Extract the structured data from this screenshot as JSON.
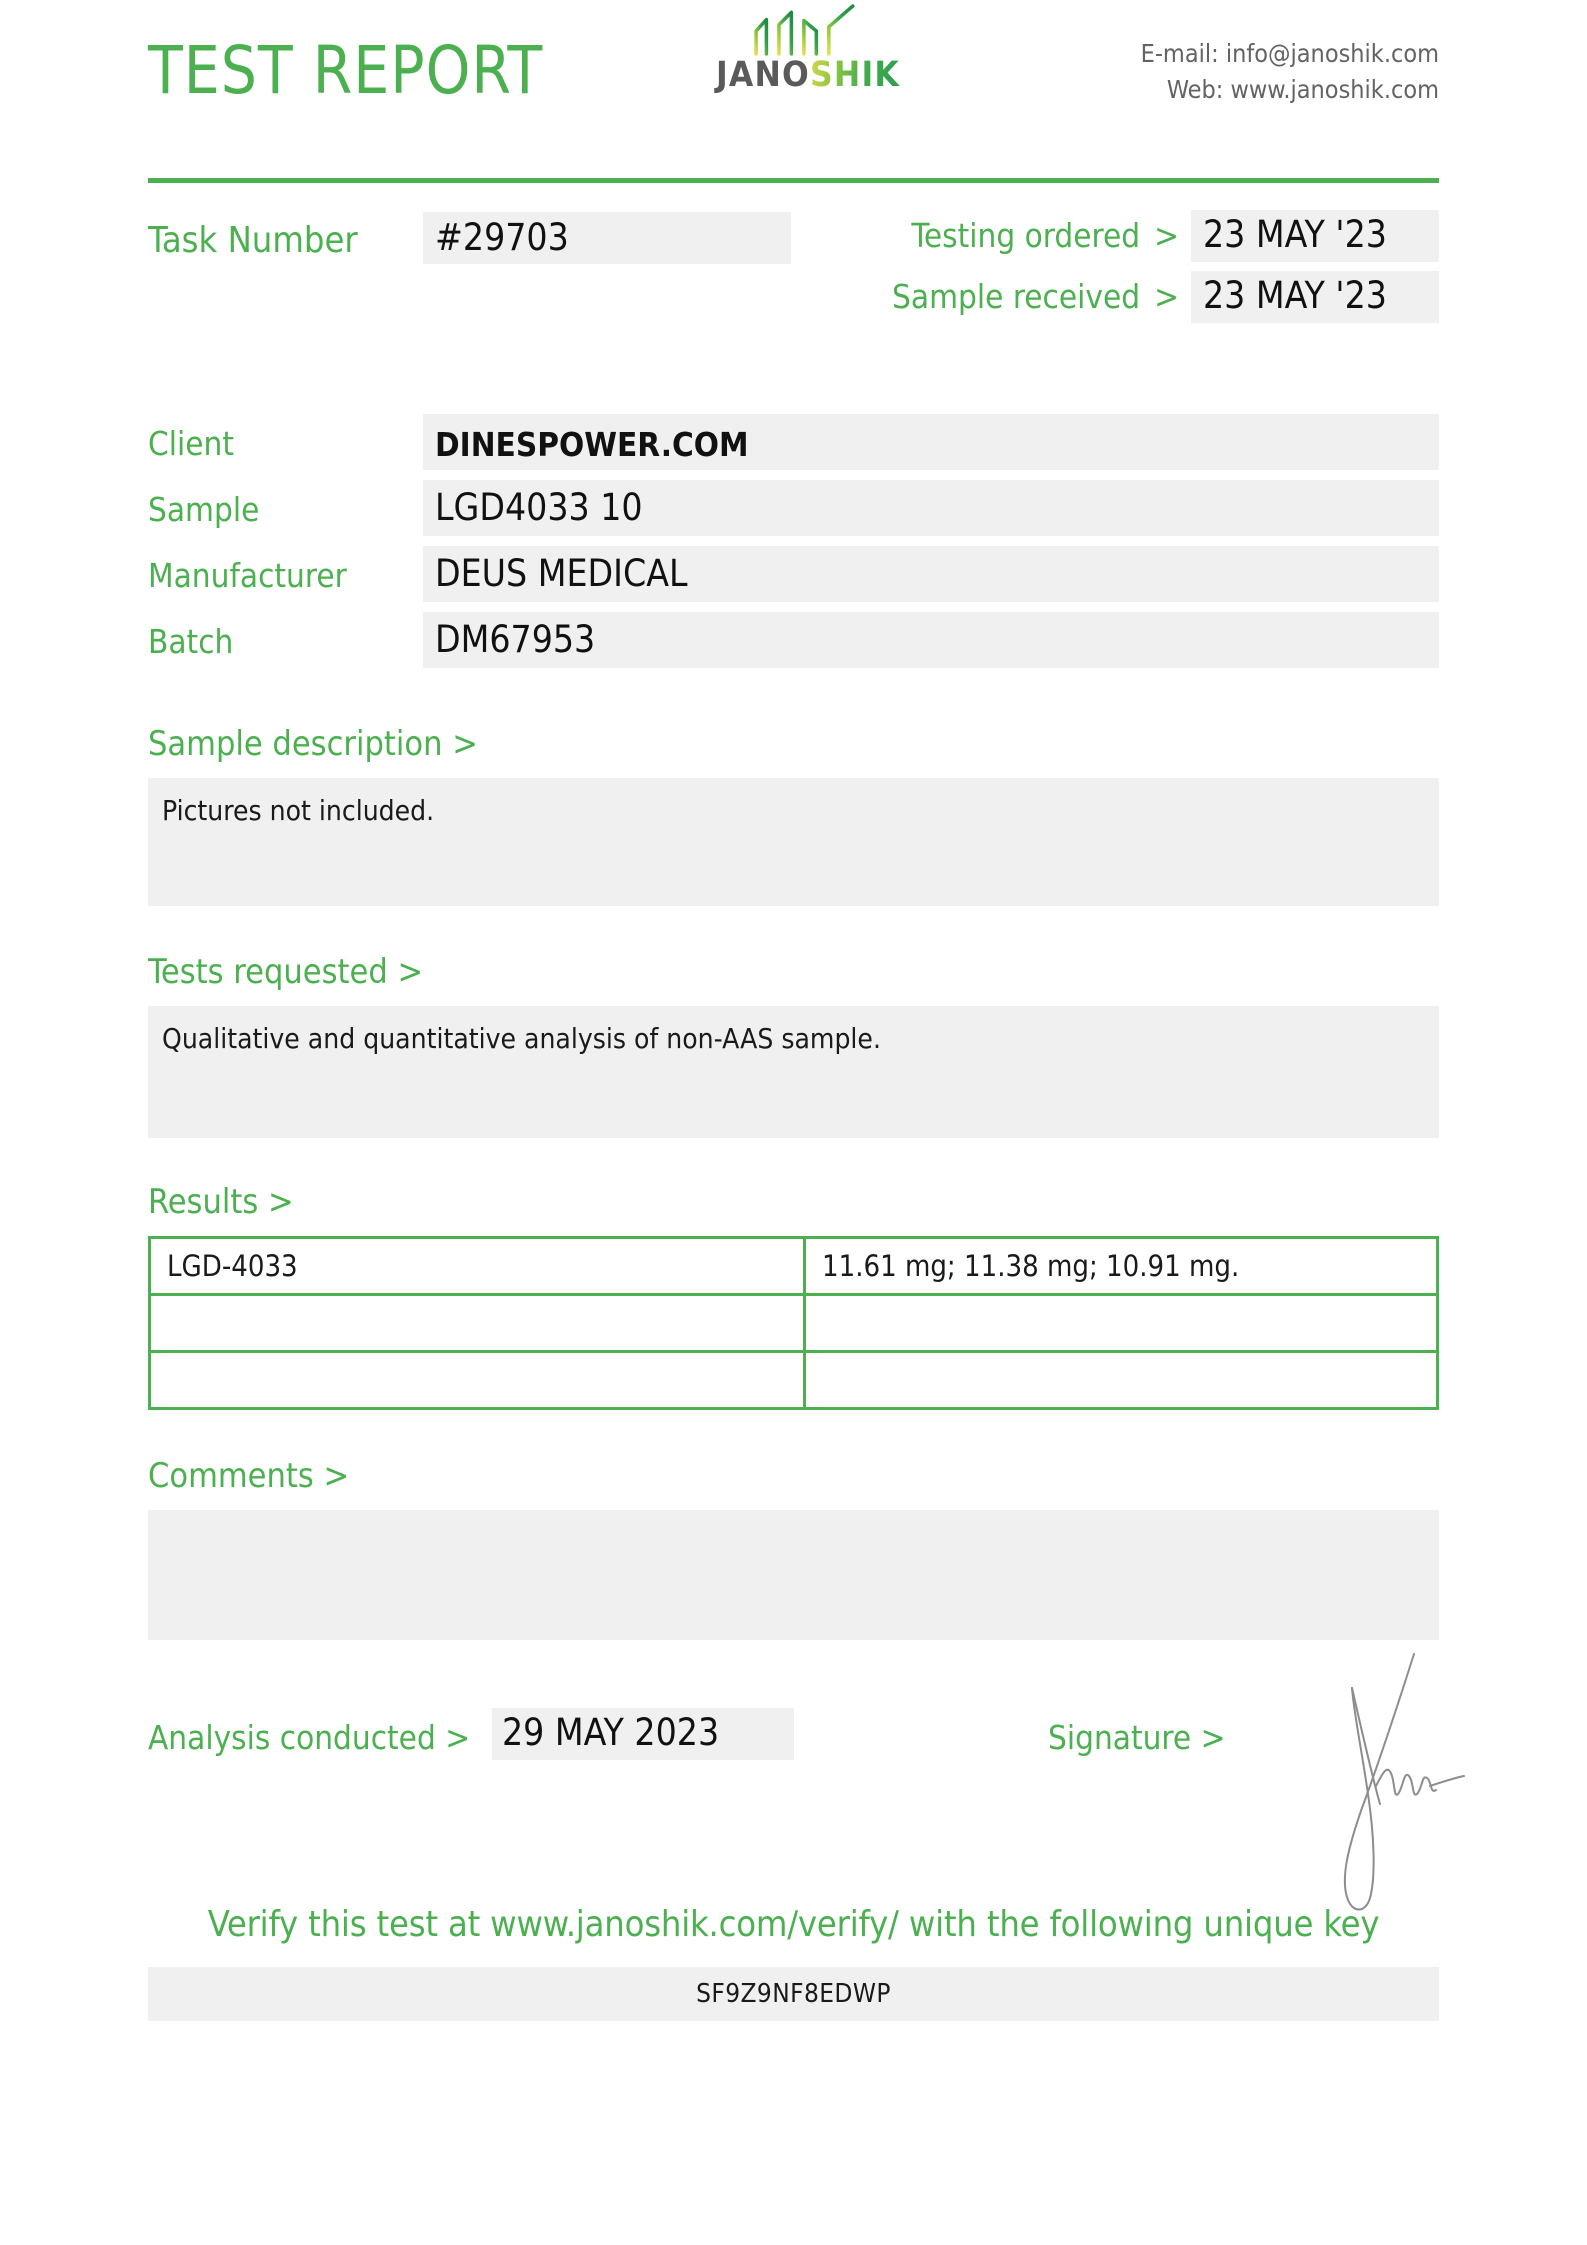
{
  "header": {
    "title": "TEST REPORT",
    "logo": {
      "word_dark": "JANO",
      "word_gradient": "SHIK",
      "mark": "chart-zigzag-icon"
    },
    "contact": {
      "email_line": "E-mail: info@janoshik.com",
      "web_line": "Web: www.janoshik.com"
    }
  },
  "task": {
    "label": "Task Number",
    "value": "#29703"
  },
  "dates": {
    "caret": ">",
    "ordered_label": "Testing ordered",
    "ordered_value": "23 MAY '23",
    "received_label": "Sample received",
    "received_value": "23 MAY '23"
  },
  "info": {
    "rows": [
      {
        "label": "Client",
        "value": "DINESPOWER.COM",
        "bold": true
      },
      {
        "label": "Sample",
        "value": "LGD4033 10",
        "bold": false
      },
      {
        "label": "Manufacturer",
        "value": "DEUS MEDICAL",
        "bold": false
      },
      {
        "label": "Batch",
        "value": "DM67953",
        "bold": false
      }
    ]
  },
  "sample_description": {
    "heading": "Sample description >",
    "text": "Pictures not included."
  },
  "tests_requested": {
    "heading": "Tests requested >",
    "text": "Qualitative and quantitative analysis of non-AAS sample."
  },
  "results": {
    "heading": "Results >",
    "rows": [
      {
        "substance": "LGD-4033",
        "value": "11.61 mg; 11.38 mg; 10.91 mg."
      },
      {
        "substance": "",
        "value": ""
      },
      {
        "substance": "",
        "value": ""
      }
    ]
  },
  "comments": {
    "heading": "Comments >",
    "text": ""
  },
  "analysis": {
    "label": "Analysis conducted >",
    "value": "29 MAY 2023",
    "signature_label": "Signature >",
    "signature": "handwritten-signature"
  },
  "footer": {
    "verify_text": "Verify this test at www.janoshik.com/verify/ with the following unique key",
    "unique_key": "SF9Z9NF8EDWP"
  },
  "colors": {
    "green": "#4cb050",
    "field_gray": "#f0f0f0",
    "text_dark": "#1a1a1a",
    "contact_gray": "#636363"
  }
}
